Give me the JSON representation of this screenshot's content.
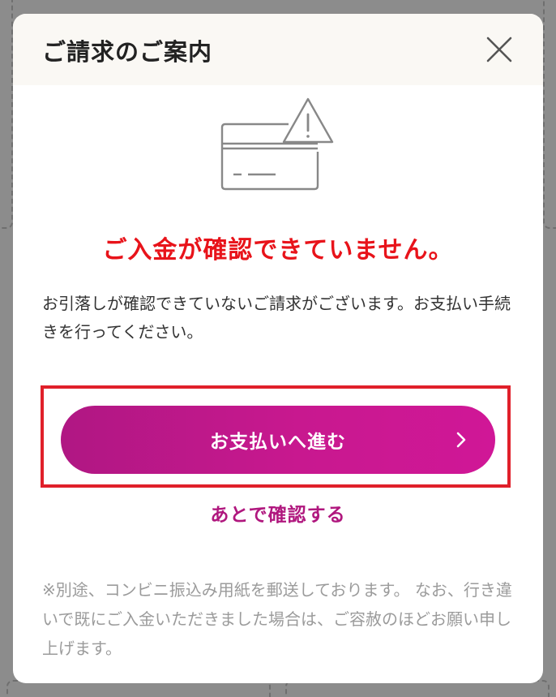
{
  "modal": {
    "title": "ご請求のご案内",
    "close_icon": "close-icon",
    "illustration_icon": "credit-card-warning-icon",
    "error_heading": "ご入金が確認できていません。",
    "description": "お引落しが確認できていないご請求がございます。お支払い手続きを行ってください。",
    "pay_button_label": "お支払いへ進む",
    "pay_button_icon": "chevron-right-icon",
    "later_link_label": "あとで確認する",
    "note": "※別途、コンビニ振込み用紙を郵送しております。 なお、行き違いで既にご入金いただきました場合は、ご容赦のほどお願い申し上げます。"
  },
  "colors": {
    "error_red": "#e8131a",
    "brand_magenta": "#c8188f",
    "link_magenta": "#b0177e",
    "highlight_border": "#e0202a",
    "header_background": "#faf8f4"
  }
}
